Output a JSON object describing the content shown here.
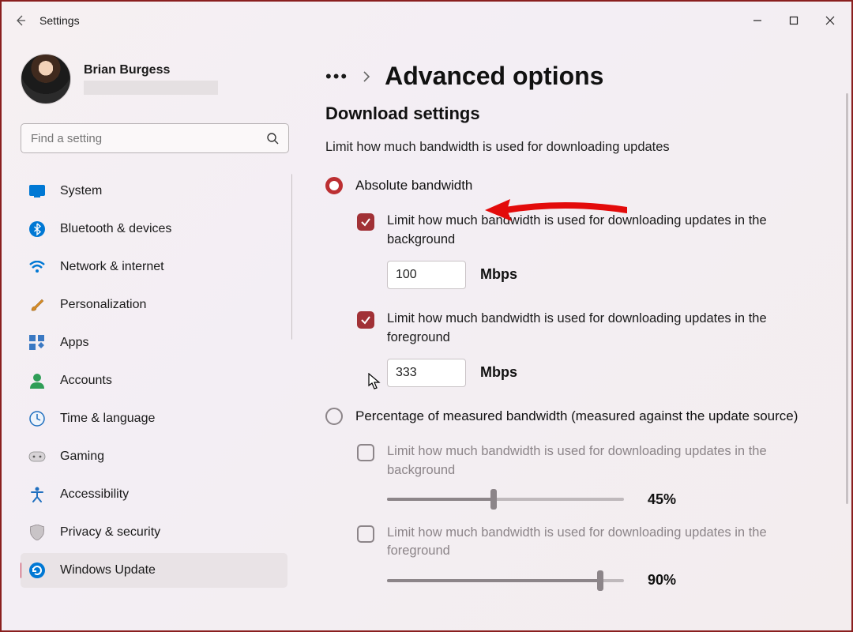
{
  "app": {
    "title": "Settings"
  },
  "user": {
    "name": "Brian Burgess"
  },
  "search": {
    "placeholder": "Find a setting"
  },
  "sidebar": {
    "items": [
      {
        "label": "System"
      },
      {
        "label": "Bluetooth & devices"
      },
      {
        "label": "Network & internet"
      },
      {
        "label": "Personalization"
      },
      {
        "label": "Apps"
      },
      {
        "label": "Accounts"
      },
      {
        "label": "Time & language"
      },
      {
        "label": "Gaming"
      },
      {
        "label": "Accessibility"
      },
      {
        "label": "Privacy & security"
      },
      {
        "label": "Windows Update"
      }
    ]
  },
  "page": {
    "heading": "Advanced options",
    "section": "Download settings",
    "intro": "Limit how much bandwidth is used for downloading updates",
    "radio_abs": "Absolute bandwidth",
    "radio_pct": "Percentage of measured bandwidth (measured against the update source)",
    "bg_label": "Limit how much bandwidth is used for downloading updates in the background",
    "fg_label": "Limit how much bandwidth is used for downloading updates in the foreground",
    "bg_value": "100",
    "fg_value": "333",
    "unit": "Mbps",
    "pct_bg": "45%",
    "pct_fg": "90%"
  }
}
